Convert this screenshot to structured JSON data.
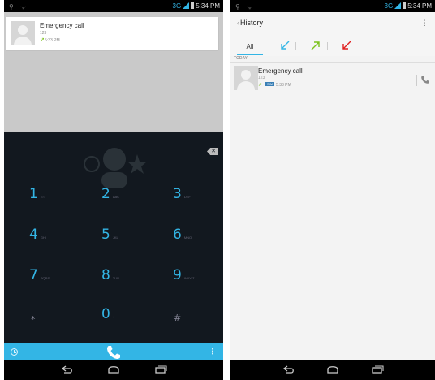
{
  "dialer_screen": {
    "status_bar": {
      "left_icons": "⚲ ᯤ",
      "network": "3G",
      "time": "5:34 PM"
    },
    "recent_call": {
      "name": "Emergency call",
      "number": "123",
      "time": "5:33 PM",
      "direction_icon": "outgoing-arrow-icon"
    },
    "keypad": [
      {
        "digit": "1",
        "letters": "⌂⌂"
      },
      {
        "digit": "2",
        "letters": "ABC"
      },
      {
        "digit": "3",
        "letters": "DEF"
      },
      {
        "digit": "4",
        "letters": "GHI"
      },
      {
        "digit": "5",
        "letters": "JKL"
      },
      {
        "digit": "6",
        "letters": "MNO"
      },
      {
        "digit": "7",
        "letters": "PQRS"
      },
      {
        "digit": "8",
        "letters": "TUV"
      },
      {
        "digit": "9",
        "letters": "WXY Z"
      },
      {
        "digit": "*",
        "letters": ""
      },
      {
        "digit": "0",
        "letters": "+"
      },
      {
        "digit": "#",
        "letters": ""
      }
    ],
    "colors": {
      "accent": "#33b5e5",
      "keypad_bg": "#12181f",
      "outgoing": "#7cc21d"
    }
  },
  "history_screen": {
    "status_bar": {
      "left_icons": "⚲ ᯤ",
      "network": "3G",
      "time": "5:34 PM"
    },
    "title": "History",
    "filter_tabs": [
      {
        "label": "All",
        "selected": true
      },
      {
        "icon": "incoming-call-icon",
        "color": "#33b5e5"
      },
      {
        "icon": "outgoing-call-icon",
        "color": "#7cc21d"
      },
      {
        "icon": "missed-call-icon",
        "color": "#e02020"
      }
    ],
    "section": "TODAY",
    "entries": [
      {
        "name": "Emergency call",
        "number": "123",
        "sim": "SIM",
        "time": "5:33 PM",
        "direction_icon": "outgoing-arrow-icon"
      }
    ]
  }
}
